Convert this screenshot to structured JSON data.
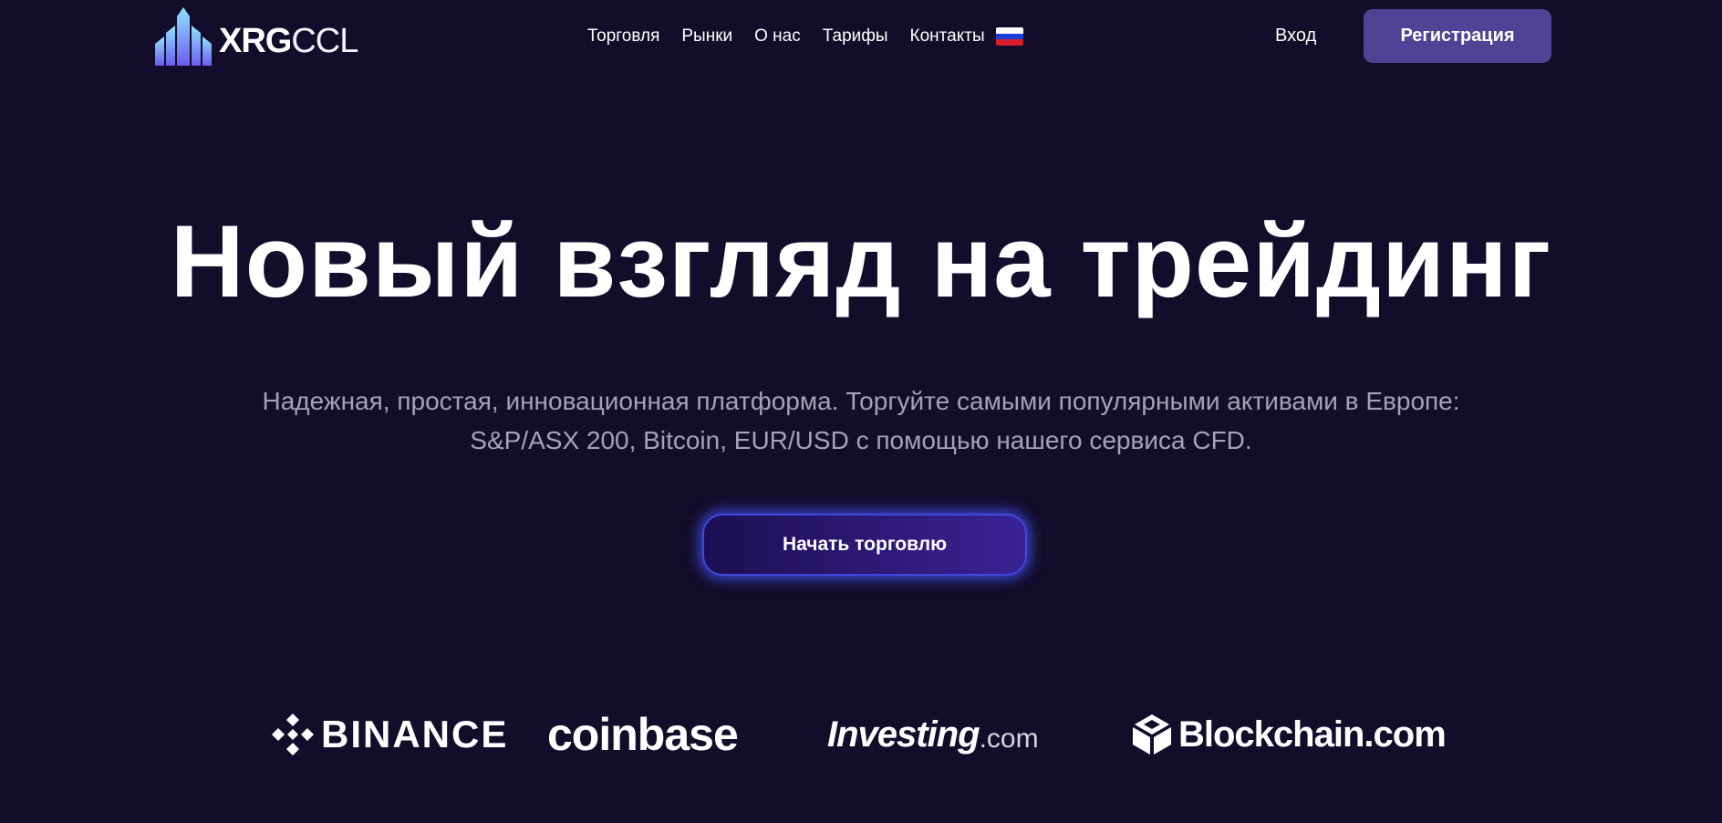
{
  "header": {
    "logo": {
      "bold": "XRG",
      "light": "CCL"
    },
    "nav": [
      {
        "label": "Торговля"
      },
      {
        "label": "Рынки"
      },
      {
        "label": "О нас"
      },
      {
        "label": "Тарифы"
      },
      {
        "label": "Контакты"
      }
    ],
    "language_flag": {
      "icon": "russian-flag-icon",
      "colors": [
        "#ffffff",
        "#1c3ed6",
        "#d81e2a"
      ]
    },
    "login_label": "Вход",
    "register_label": "Регистрация"
  },
  "hero": {
    "title": "Новый взгляд на трейдинг",
    "subtitle_line1": "Надежная, простая, инновационная платформа. Торгуйте самыми популярными активами в Европе:",
    "subtitle_line2": "S&P/ASX 200, Bitcoin, EUR/USD с помощью нашего сервиса CFD.",
    "cta_label": "Начать торговлю"
  },
  "partners": {
    "binance": "BINANCE",
    "coinbase": "coinbase",
    "investing_main": "Investing",
    "investing_suffix": ".com",
    "blockchain": "Blockchain.com"
  },
  "colors": {
    "background": "#130c2a",
    "register_button": "#4e4394",
    "cta_glow": "#465aff",
    "subtitle": "#a6a2b6"
  }
}
